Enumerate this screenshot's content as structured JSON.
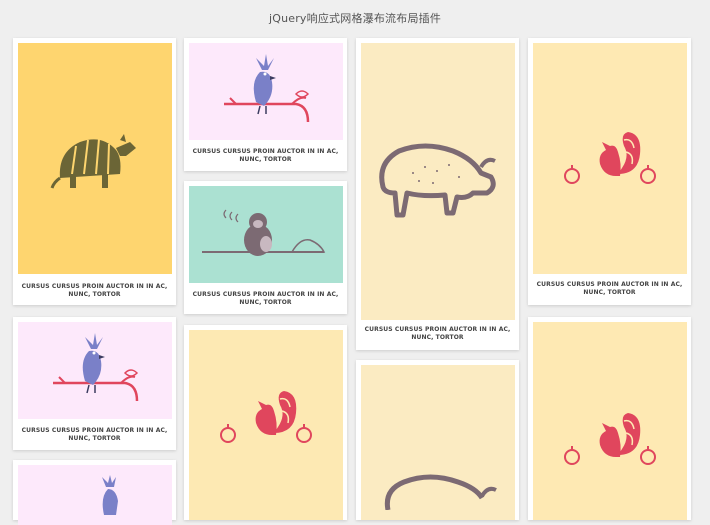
{
  "page": {
    "title": "jQuery响应式网格瀑布流布局插件"
  },
  "colors": {
    "page_bg": "#efefef",
    "card_bg": "#ffffff",
    "yellow": "#fed56f",
    "lavender": "#fde9fb",
    "mint": "#abe1d2",
    "cream": "#fbebc2",
    "pale_yellow": "#fee9b3"
  },
  "cards": [
    {
      "name": "armadillo",
      "caption": "CURSUS CURSUS PROIN AUCTOR IN IN AC, NUNC, TORTOR",
      "bg": "yellow"
    },
    {
      "name": "bird-1",
      "caption": "CURSUS CURSUS PROIN AUCTOR IN IN AC, NUNC, TORTOR",
      "bg": "lavender"
    },
    {
      "name": "monkey",
      "caption": "CURSUS CURSUS PROIN AUCTOR IN IN AC, NUNC, TORTOR",
      "bg": "mint"
    },
    {
      "name": "bison",
      "caption": "CURSUS CURSUS PROIN AUCTOR IN IN AC, NUNC, TORTOR",
      "bg": "cream"
    },
    {
      "name": "squirrel-1",
      "caption": "CURSUS CURSUS PROIN AUCTOR IN IN AC, NUNC, TORTOR",
      "bg": "pale_yellow"
    },
    {
      "name": "bird-2",
      "caption": "CURSUS CURSUS PROIN AUCTOR IN IN AC, NUNC, TORTOR",
      "bg": "lavender"
    },
    {
      "name": "squirrel-2",
      "caption": "",
      "bg": "pale_yellow"
    },
    {
      "name": "bison-2",
      "caption": "",
      "bg": "cream"
    },
    {
      "name": "squirrel-3",
      "caption": "",
      "bg": "pale_yellow"
    },
    {
      "name": "bird-3",
      "caption": "",
      "bg": "lavender"
    }
  ],
  "icons": {
    "armadillo": "armadillo-icon",
    "bird": "bird-on-branch-icon",
    "monkey": "monkey-on-branch-icon",
    "bison": "bison-icon",
    "squirrel": "squirrel-icon"
  }
}
